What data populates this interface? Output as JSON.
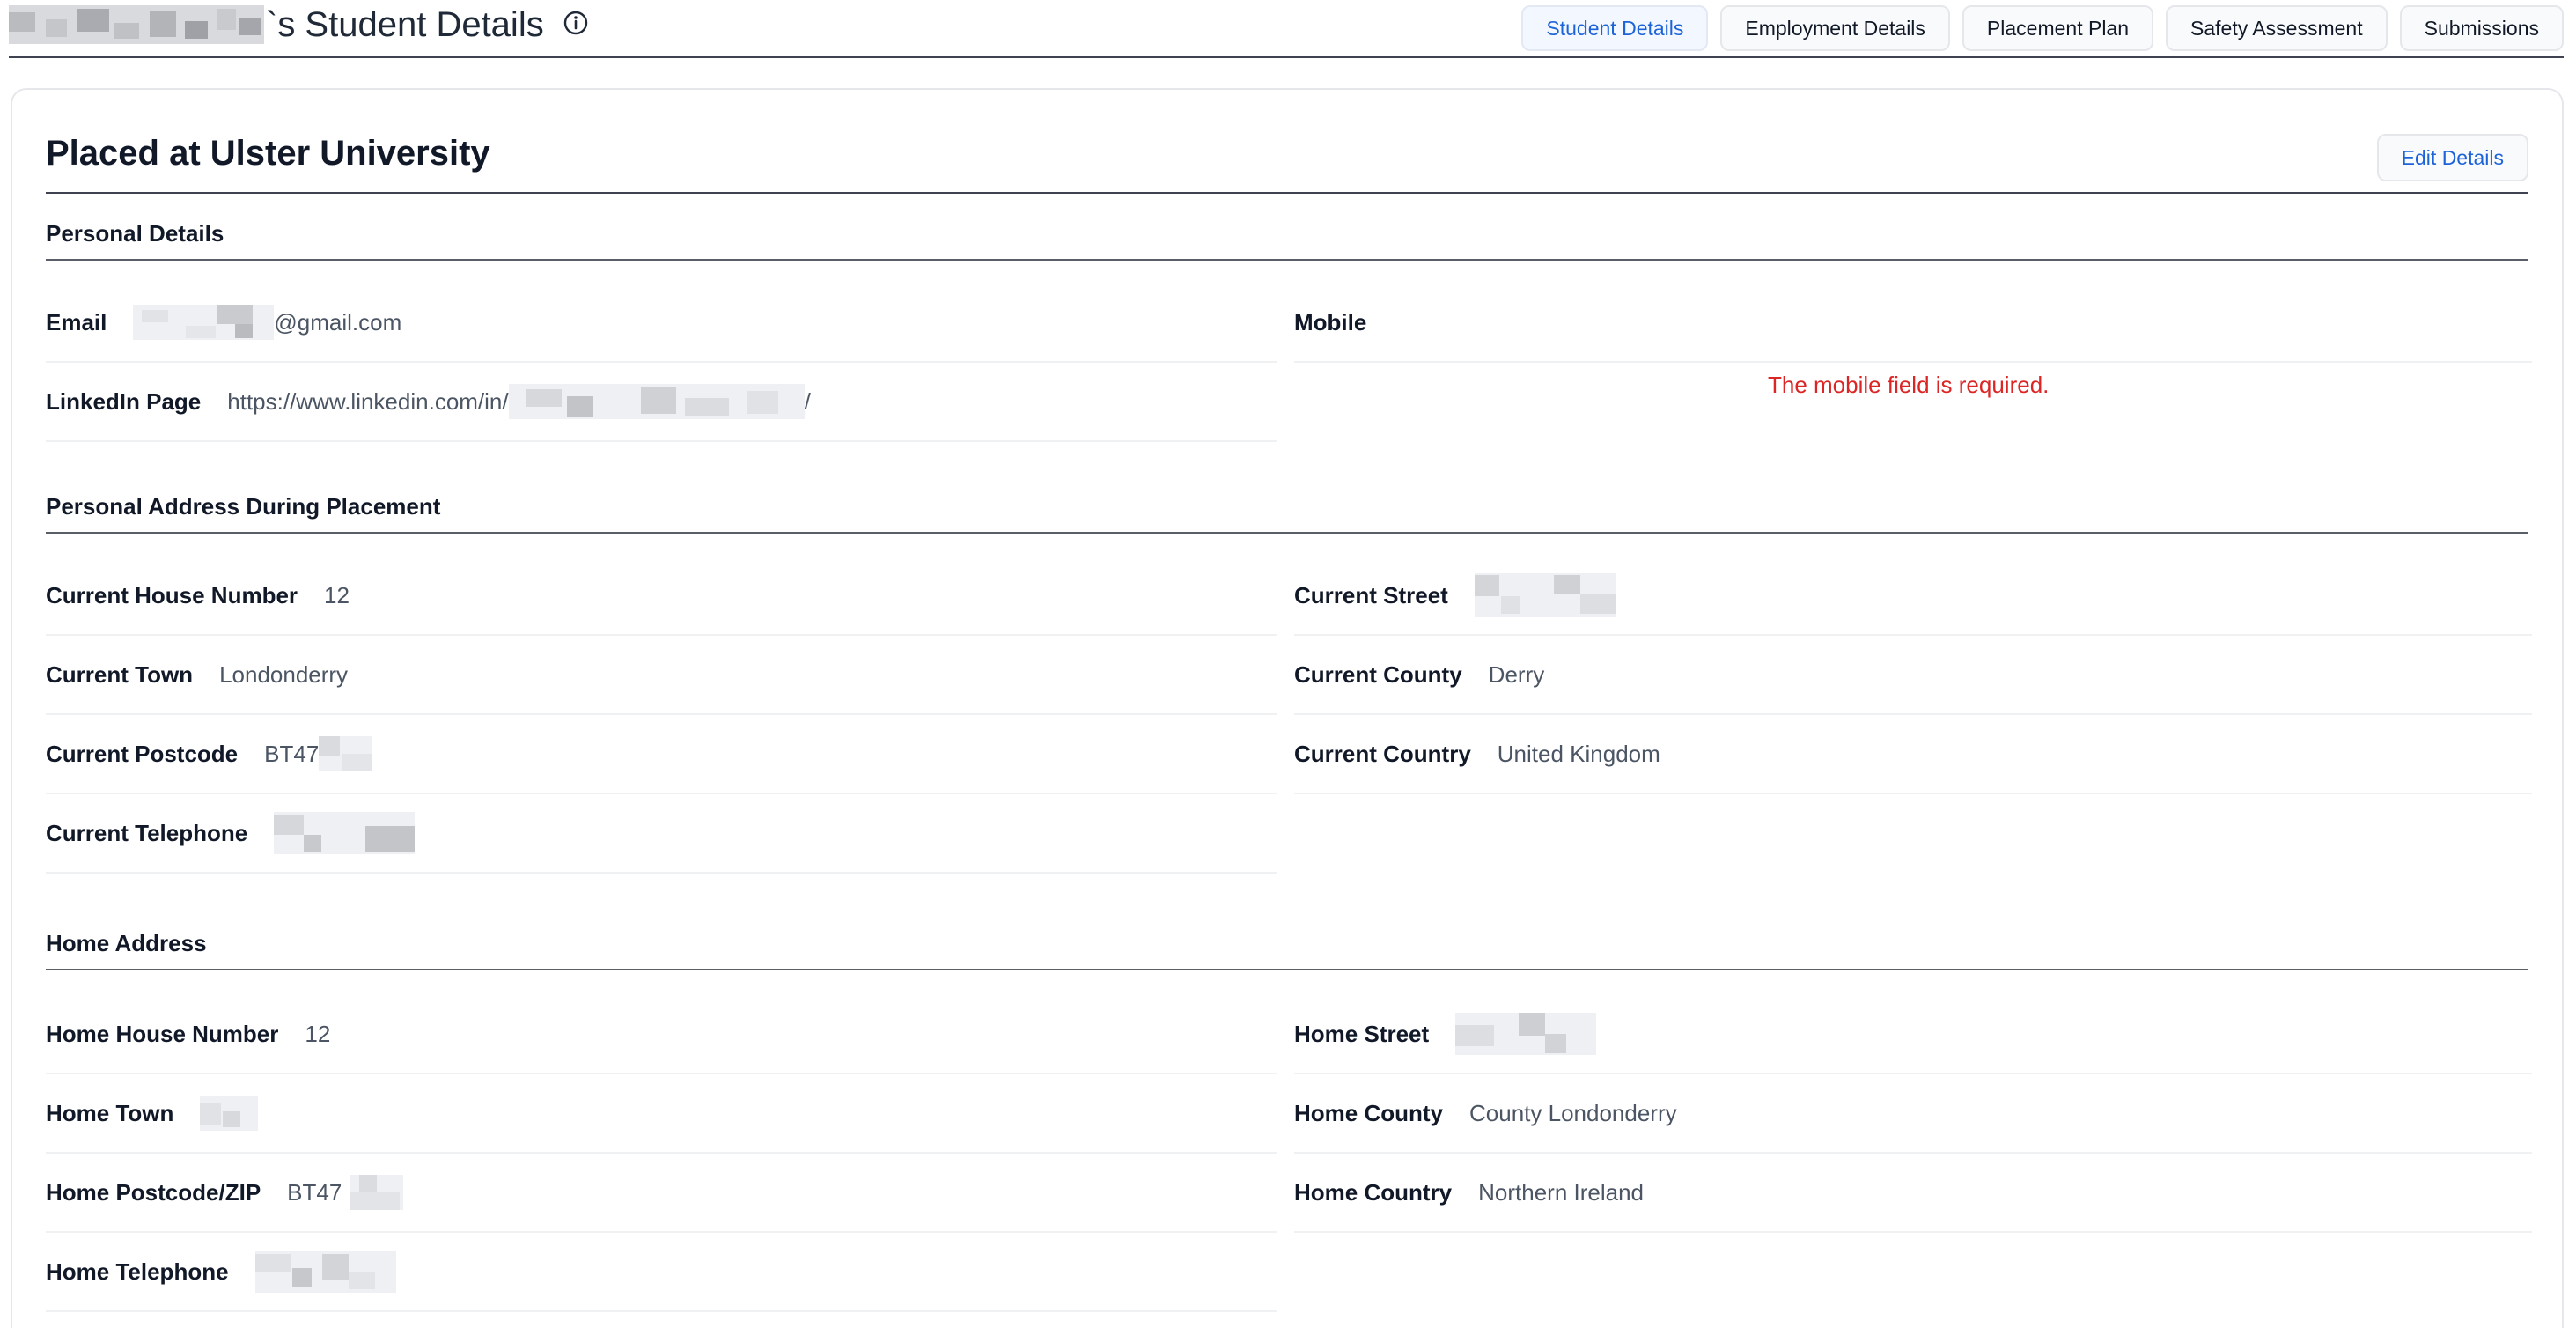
{
  "header": {
    "title_suffix": "`s Student Details",
    "info_icon": "info-circle-icon",
    "tabs": [
      {
        "label": "Student Details",
        "active": true
      },
      {
        "label": "Employment Details",
        "active": false
      },
      {
        "label": "Placement Plan",
        "active": false
      },
      {
        "label": "Safety Assessment",
        "active": false
      },
      {
        "label": "Submissions",
        "active": false
      }
    ]
  },
  "card": {
    "title": "Placed at Ulster University",
    "edit_label": "Edit Details"
  },
  "sections": {
    "personal": "Personal Details",
    "placement_address": "Personal Address During Placement",
    "home_address": "Home Address"
  },
  "personal": {
    "email_label": "Email",
    "email_value": "@gmail.com",
    "linkedin_label": "LinkedIn Page",
    "linkedin_value_prefix": "https://www.linkedin.com/in/",
    "linkedin_value_suffix": "/",
    "mobile_label": "Mobile",
    "mobile_error": "The mobile field is required."
  },
  "placement": {
    "house_number_label": "Current House Number",
    "house_number_value": "12",
    "street_label": "Current Street",
    "town_label": "Current Town",
    "town_value": "Londonderry",
    "county_label": "Current County",
    "county_value": "Derry",
    "postcode_label": "Current Postcode",
    "postcode_value": "BT47",
    "country_label": "Current Country",
    "country_value": "United Kingdom",
    "telephone_label": "Current Telephone"
  },
  "home": {
    "house_number_label": "Home House Number",
    "house_number_value": "12",
    "street_label": "Home Street",
    "town_label": "Home Town",
    "county_label": "Home County",
    "county_value": "County Londonderry",
    "postcode_label": "Home Postcode/ZIP",
    "postcode_value": "BT47",
    "country_label": "Home Country",
    "country_value": "Northern Ireland",
    "telephone_label": "Home Telephone"
  },
  "colors": {
    "accent": "#1d63d8",
    "error": "#dc2626",
    "rule": "#3f4350"
  }
}
